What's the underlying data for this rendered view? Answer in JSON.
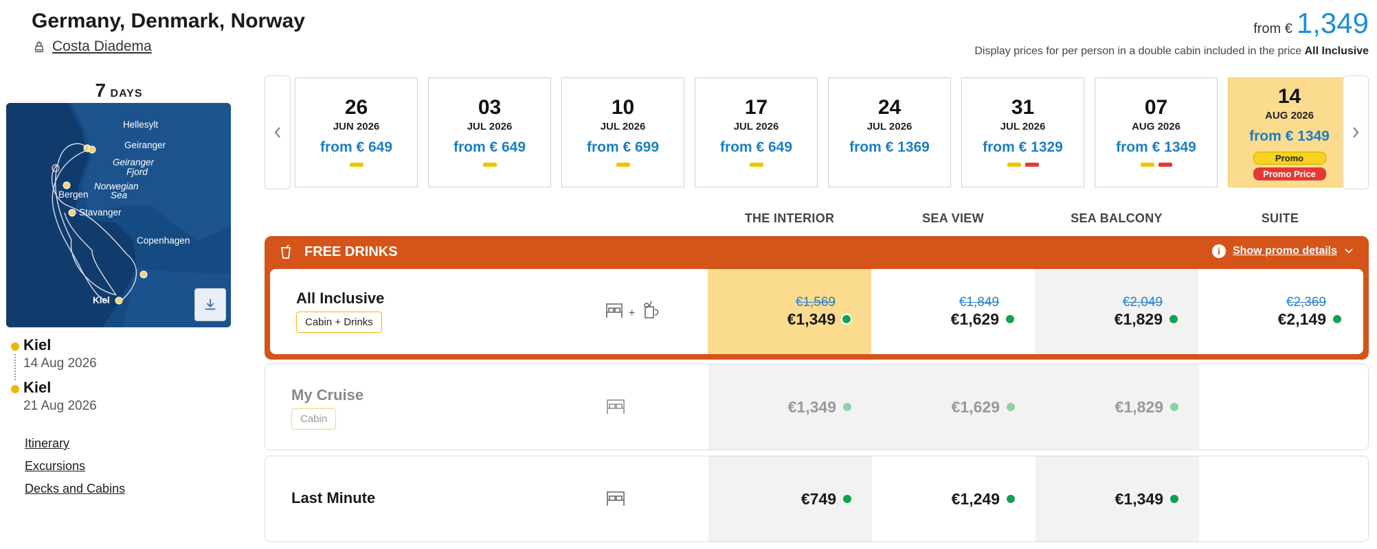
{
  "header": {
    "title": "Germany, Denmark, Norway",
    "ship_name": "Costa Diadema",
    "price_from_label": "from €",
    "price_from_value": "1,349",
    "display_note_prefix": "Display prices for per person in a double cabin included in the price",
    "display_note_bold": "All Inclusive"
  },
  "sidebar": {
    "days_number": "7",
    "days_label": "DAYS",
    "map_labels": [
      "Hellesylt",
      "Geiranger",
      "Geiranger",
      "Fjord",
      "Norwegian",
      "Sea",
      "Bergen",
      "Stavanger",
      "Copenhagen",
      "Kiel"
    ],
    "stops": [
      {
        "name": "Kiel",
        "date": "14 Aug 2026"
      },
      {
        "name": "Kiel",
        "date": "21 Aug 2026"
      }
    ],
    "links": [
      "Itinerary",
      "Excursions",
      "Decks and Cabins"
    ]
  },
  "dates": [
    {
      "day": "26",
      "month": "JUN 2026",
      "price": "from € 649",
      "bars": [
        "yellow"
      ]
    },
    {
      "day": "03",
      "month": "JUL 2026",
      "price": "from € 649",
      "bars": [
        "yellow"
      ]
    },
    {
      "day": "10",
      "month": "JUL 2026",
      "price": "from € 699",
      "bars": [
        "yellow"
      ]
    },
    {
      "day": "17",
      "month": "JUL 2026",
      "price": "from € 649",
      "bars": [
        "yellow"
      ]
    },
    {
      "day": "24",
      "month": "JUL 2026",
      "price": "from € 1369",
      "bars": []
    },
    {
      "day": "31",
      "month": "JUL 2026",
      "price": "from € 1329",
      "bars": [
        "yellow",
        "red"
      ]
    },
    {
      "day": "07",
      "month": "AUG 2026",
      "price": "from € 1349",
      "bars": [
        "yellow",
        "red"
      ]
    },
    {
      "day": "14",
      "month": "AUG 2026",
      "price": "from € 1349",
      "badges": [
        "Promo",
        "Promo Price"
      ],
      "selected": true
    }
  ],
  "columns": [
    "THE INTERIOR",
    "SEA VIEW",
    "SEA BALCONY",
    "SUITE"
  ],
  "offer": {
    "title": "FREE DRINKS",
    "promo_link": "Show promo details"
  },
  "rows": [
    {
      "name": "All Inclusive",
      "tag": "Cabin + Drinks",
      "icon": "bed-plus-drink-icon",
      "prices": [
        {
          "old": "€1,569",
          "cur": "€1,349"
        },
        {
          "old": "€1,849",
          "cur": "€1,629"
        },
        {
          "old": "€2,049",
          "cur": "€1,829"
        },
        {
          "old": "€2,369",
          "cur": "€2,149"
        }
      ]
    },
    {
      "name": "My Cruise",
      "tag": "Cabin",
      "icon": "bed-icon",
      "prices": [
        {
          "cur": "€1,349"
        },
        {
          "cur": "€1,629"
        },
        {
          "cur": "€1,829"
        }
      ]
    },
    {
      "name": "Last Minute",
      "icon": "bed-icon",
      "prices": [
        {
          "cur": "€749"
        },
        {
          "cur": "€1,249"
        },
        {
          "cur": "€1,349"
        }
      ]
    }
  ],
  "colors": {
    "accent_blue": "#1a8fd6",
    "price_blue": "#1b7fc0",
    "offer_orange": "#d4541a",
    "highlight_yellow": "#fbdc8f",
    "available_green": "#12a150",
    "promo_red": "#e53935"
  }
}
